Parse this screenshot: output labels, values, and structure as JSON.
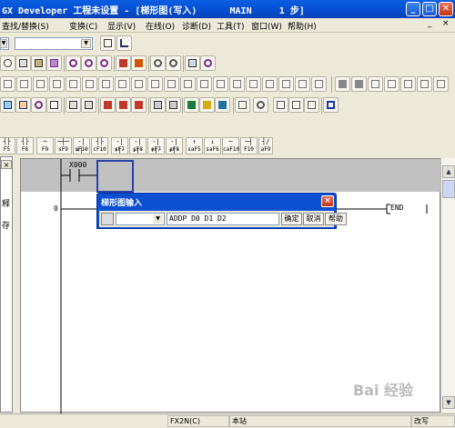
{
  "window": {
    "title": "GX Developer 工程未设置 - [梯形图(写入)      MAIN     1 步]",
    "min_label": "_",
    "max_label": "□",
    "close_label": "✕"
  },
  "menu": [
    {
      "label": "查找/替换(S)"
    },
    {
      "label": "变换(C)"
    },
    {
      "label": "显示(V)"
    },
    {
      "label": "在线(O)"
    },
    {
      "label": "诊断(D)"
    },
    {
      "label": "工具(T)"
    },
    {
      "label": "窗口(W)"
    },
    {
      "label": "帮助(H)"
    }
  ],
  "menu_right_min": "_",
  "menu_right_close": "×",
  "fkeys": [
    {
      "sym": "┤├",
      "label": "F5"
    },
    {
      "sym": "┤/├",
      "label": "sF5"
    },
    {
      "sym": "┤├",
      "label": "F6"
    },
    {
      "sym": "┤/├",
      "label": "sF6"
    },
    {
      "sym": "─",
      "label": "F9"
    },
    {
      "sym": "─┼─",
      "label": "sF9"
    },
    {
      "sym": "-|×|-",
      "label": "cF10"
    },
    {
      "sym": "-|↑|-",
      "label": "sF7"
    },
    {
      "sym": "-|↓|-",
      "label": "sF8"
    },
    {
      "sym": "-|↑|-",
      "label": "aF7"
    },
    {
      "sym": "-|↓|-",
      "label": "aF8"
    },
    {
      "sym": "↑",
      "label": "saF5"
    },
    {
      "sym": "↓",
      "label": "saF6"
    },
    {
      "sym": "─",
      "label": "caF10"
    },
    {
      "sym": "─┤",
      "label": "F10"
    },
    {
      "sym": "┤/",
      "label": "aF9"
    }
  ],
  "left_panel": {
    "close": "×",
    "text1": "释",
    "text2": "存"
  },
  "ladder": {
    "contact_label": "X000",
    "step": "0",
    "end_label": "END"
  },
  "dialog": {
    "title": "梯形图输入",
    "instruction": "ADDP D0 D1 D2",
    "confirm": "确定",
    "cancel": "取消",
    "help": "帮助"
  },
  "status": {
    "plc": "FX2N(C)",
    "station": "本站",
    "mode": "改写"
  },
  "watermark": "Bai 经验",
  "colors": {
    "titlebar": "#0551d6",
    "dialog": "#0b4fd2",
    "cursor": "#2a3fa8"
  }
}
